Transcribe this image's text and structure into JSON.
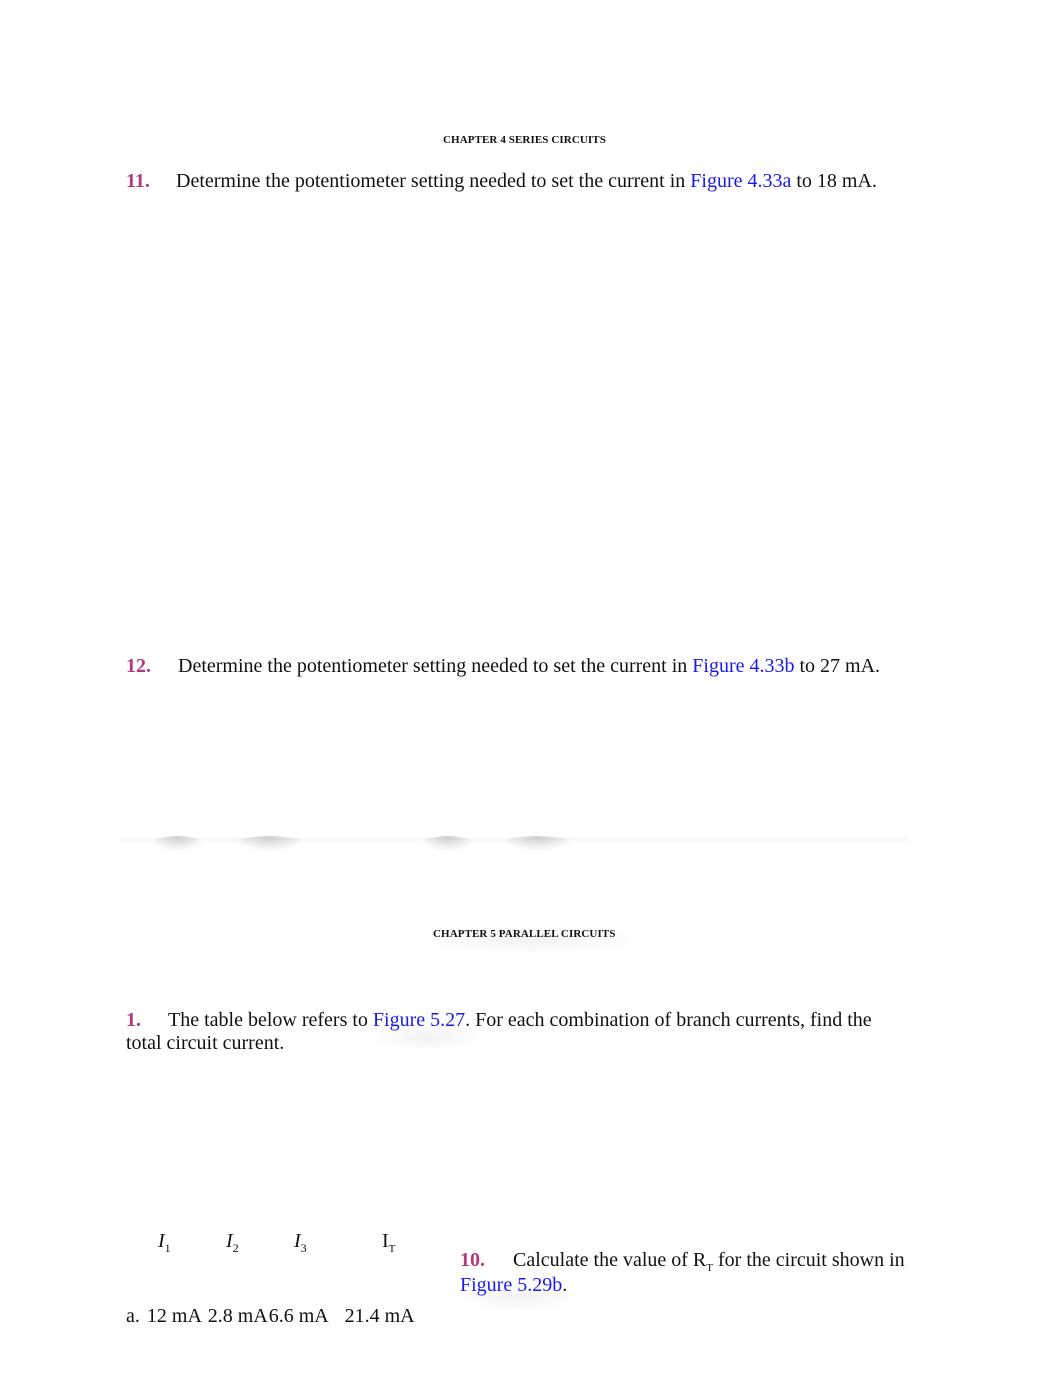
{
  "chapter4": {
    "heading": "CHAPTER 4 SERIES CIRCUITS",
    "questions": [
      {
        "number": "11.",
        "text_before": "Determine the potentiometer setting needed to set the current in ",
        "link": "Figure 4.33a",
        "text_after": " to 18 mA."
      },
      {
        "number": "12.",
        "text_before": "Determine the potentiometer setting needed to set the current in ",
        "link": "Figure 4.33b",
        "text_after": " to 27 mA."
      }
    ]
  },
  "chapter5": {
    "heading": "CHAPTER 5 PARALLEL CIRCUITS",
    "question1": {
      "number": "1.",
      "text_before": "The table below refers to ",
      "link": "Figure 5.27",
      "text_after": ". For each combination of branch currents, find the",
      "text_line2": "total circuit current."
    },
    "table": {
      "headers": [
        {
          "symbol": "I",
          "sub": "1"
        },
        {
          "symbol": "I",
          "sub": "2"
        },
        {
          "symbol": "I",
          "sub": "3"
        },
        {
          "symbol": "I",
          "sub": "T"
        }
      ],
      "rows": [
        {
          "label": "a.",
          "values": [
            "12 mA",
            "2.8 mA",
            "6.6 mA",
            "21.4 mA"
          ]
        }
      ]
    },
    "question10": {
      "number": "10.",
      "text_before": "Calculate the value of R",
      "subscript": "T",
      "text_after": " for the circuit shown in",
      "link": "Figure 5.29b",
      "period": "."
    }
  }
}
